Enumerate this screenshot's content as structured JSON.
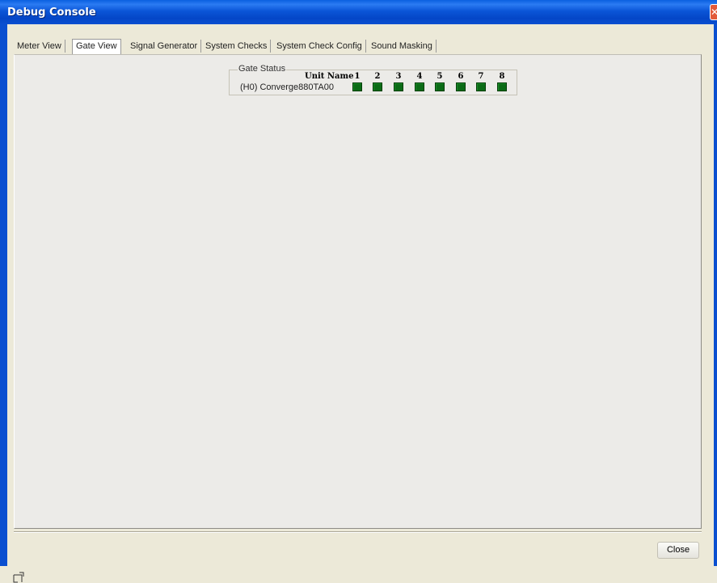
{
  "window": {
    "title": "Debug Console"
  },
  "tabs": [
    {
      "label": "Meter View"
    },
    {
      "label": "Gate View",
      "active": true
    },
    {
      "label": "Signal Generator"
    },
    {
      "label": "System Checks"
    },
    {
      "label": "System Check Config"
    },
    {
      "label": "Sound Masking"
    }
  ],
  "gate_status": {
    "group_label": "Gate Status",
    "unit_name_header": "Unit Name",
    "channel_headers": [
      "1",
      "2",
      "3",
      "4",
      "5",
      "6",
      "7",
      "8"
    ],
    "rows": [
      {
        "unit_name": "(H0) Converge880TA00",
        "gates": [
          "on",
          "on",
          "on",
          "on",
          "on",
          "on",
          "on",
          "on"
        ]
      }
    ],
    "gate_on_color": "#0b6b16"
  },
  "footer": {
    "close_label": "Close"
  },
  "colors": {
    "titlebar": "#0b56d8",
    "background": "#ece9d8"
  }
}
